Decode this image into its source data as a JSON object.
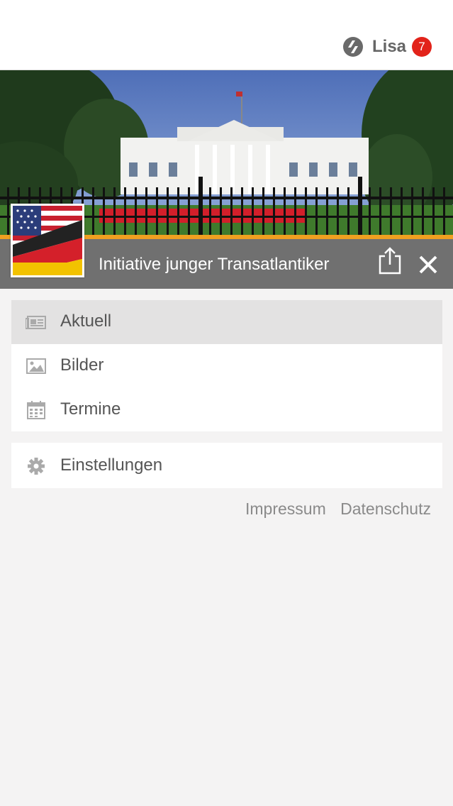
{
  "header": {
    "user_name": "Lisa",
    "notification_count": "7",
    "app_icon": "app-logo-icon",
    "badge_color": "#e2231a"
  },
  "group": {
    "title": "Initiative junger Transatlantiker",
    "logo": "us-germany-flag",
    "accent_color": "#f0a020",
    "share_icon": "share-icon",
    "close_icon": "close-icon"
  },
  "menu": {
    "items": [
      {
        "label": "Aktuell",
        "icon": "newspaper-icon",
        "active": true
      },
      {
        "label": "Bilder",
        "icon": "image-icon",
        "active": false
      },
      {
        "label": "Termine",
        "icon": "calendar-icon",
        "active": false
      }
    ],
    "settings": {
      "label": "Einstellungen",
      "icon": "gear-icon"
    }
  },
  "footer": {
    "impressum": "Impressum",
    "datenschutz": "Datenschutz"
  }
}
